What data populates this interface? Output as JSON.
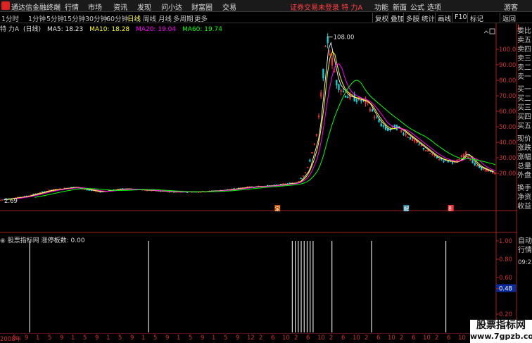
{
  "topbar": {
    "app_title": "通达信金融终端",
    "menu": [
      "行情",
      "市场",
      "资讯",
      "发现",
      "问小达",
      "财富圈",
      "交易"
    ],
    "notice": "证券交易未登录  特 力A",
    "right_menu": [
      "功能",
      "新面",
      "公式",
      "选项"
    ],
    "guest": "游客"
  },
  "timeframes": {
    "items": [
      "1分时",
      "1分钟",
      "5分钟",
      "15分钟",
      "30分钟",
      "60分钟",
      "日线",
      "周线",
      "月线",
      "多周期",
      "更多"
    ],
    "active": "日线"
  },
  "toolbar": [
    "复权",
    "叠加",
    "多股",
    "统计",
    "画线",
    "F10",
    "标记",
    "返回"
  ],
  "header": {
    "stock": "特 力A",
    "period": "(日线)",
    "ma5": "MA5: 18.23",
    "ma10": "MA10: 18.28",
    "ma20": "MA20: 19.04",
    "ma60": "MA60: 19.74"
  },
  "colors": {
    "up": "#ff3333",
    "down": "#00e0e0",
    "ma5": "#e8e8e8",
    "ma10": "#ffff00",
    "ma20": "#ff00ff",
    "ma60": "#00ff00",
    "axis": "#cc2222"
  },
  "side_labels": [
    "委比",
    "卖五",
    "卖四",
    "卖三",
    "卖二",
    "卖一",
    "买一",
    "买二",
    "买三",
    "买四",
    "买五",
    "现价",
    "涨跌",
    "涨幅",
    "总量",
    "外盘",
    "换手",
    "净资",
    "收益"
  ],
  "side_top": "L",
  "ind_side_labels": [
    "自动",
    "行情",
    "09:25"
  ],
  "price_axis": [
    "100.0",
    "90.00",
    "80.00",
    "70.00",
    "60.00",
    "50.00",
    "40.00",
    "30.00",
    "20.00"
  ],
  "price_max_label": "108.00",
  "price_min_label": "2.69",
  "event_markers": [
    "定",
    "解",
    "8"
  ],
  "indicator": {
    "name": "股票指标网",
    "label": "涨停板数: 0.00",
    "axis": [
      "1.00",
      "0.80",
      "0.60",
      "0.48",
      "0.20"
    ]
  },
  "x_axis": [
    "2008年",
    "5",
    "9",
    "1",
    "5",
    "9",
    "1",
    "5",
    "9",
    "1",
    "5",
    "9",
    "1",
    "5",
    "9",
    "1",
    "5",
    "9",
    "1",
    "5",
    "9",
    "12",
    "2",
    "6",
    "10",
    "2",
    "6",
    "10",
    "2",
    "6",
    "10",
    "2",
    "6",
    "10",
    "2",
    "6",
    "10",
    "2",
    "6",
    "10"
  ],
  "watermark": {
    "line1": "股票指标网",
    "line2": "www.7gpzb.com"
  },
  "chart_data": {
    "type": "line",
    "title": "特 力A (日线)",
    "ylim": [
      0,
      110
    ],
    "x": [
      0,
      5,
      10,
      15,
      20,
      25,
      30,
      35,
      40,
      45,
      50,
      55,
      60,
      62,
      64,
      66,
      68,
      70,
      72,
      74,
      76,
      78,
      80,
      82,
      84,
      86,
      88,
      90,
      92,
      94,
      96,
      98,
      100
    ],
    "series": [
      {
        "name": "close",
        "values": [
          2.69,
          5,
          9,
          11,
          8,
          10,
          9,
          8,
          8,
          9,
          11,
          12,
          14,
          22,
          45,
          108,
          78,
          70,
          68,
          66,
          55,
          48,
          50,
          45,
          40,
          35,
          30,
          28,
          27,
          33,
          25,
          22,
          20
        ]
      }
    ],
    "indicator_spikes": [
      6,
      30,
      59,
      59.6,
      60.2,
      60.8,
      61.4,
      62,
      62.6,
      63.2,
      67,
      75,
      90
    ]
  }
}
